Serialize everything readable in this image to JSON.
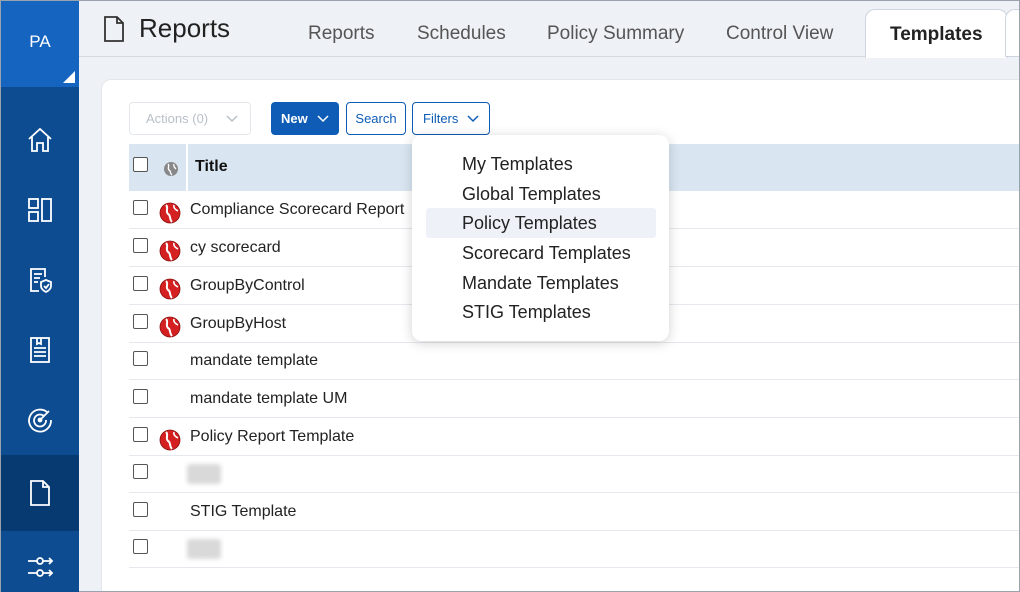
{
  "sidebar": {
    "avatar_initials": "PA",
    "items": [
      {
        "icon": "home-icon"
      },
      {
        "icon": "dashboard-icon"
      },
      {
        "icon": "policy-shield-icon"
      },
      {
        "icon": "report-document-icon"
      },
      {
        "icon": "radar-icon"
      },
      {
        "icon": "reports-file-icon",
        "active": true
      },
      {
        "icon": "workflow-icon"
      }
    ]
  },
  "header": {
    "title": "Reports",
    "tabs": [
      {
        "label": "Reports"
      },
      {
        "label": "Schedules"
      },
      {
        "label": "Policy Summary"
      },
      {
        "label": "Control View"
      },
      {
        "label": "Templates",
        "active": true
      }
    ]
  },
  "toolbar": {
    "actions_label": "Actions (0)",
    "new_label": "New",
    "search_label": "Search",
    "filters_label": "Filters"
  },
  "table": {
    "title_header": "Title",
    "rows": [
      {
        "title": "Compliance Scorecard Report",
        "global": true
      },
      {
        "title": "cy scorecard",
        "global": true
      },
      {
        "title": "GroupByControl",
        "global": true
      },
      {
        "title": "GroupByHost",
        "global": true
      },
      {
        "title": "mandate template",
        "global": false
      },
      {
        "title": "mandate template UM",
        "global": false
      },
      {
        "title": "Policy Report Template",
        "global": true
      },
      {
        "title": "",
        "global": false,
        "redacted": true
      },
      {
        "title": "STIG Template",
        "global": false
      },
      {
        "title": "",
        "global": false,
        "redacted": true
      }
    ]
  },
  "filters_menu": {
    "items": [
      {
        "label": "My Templates"
      },
      {
        "label": "Global Templates"
      },
      {
        "label": "Policy Templates",
        "highlighted": true
      },
      {
        "label": "Scorecard Templates"
      },
      {
        "label": "Mandate Templates"
      },
      {
        "label": "STIG Templates"
      }
    ]
  },
  "colors": {
    "sidebar": "#0e4c91",
    "primary": "#0e5cb5",
    "table_header": "#d9e6f1",
    "global_icon": "#d42020"
  }
}
